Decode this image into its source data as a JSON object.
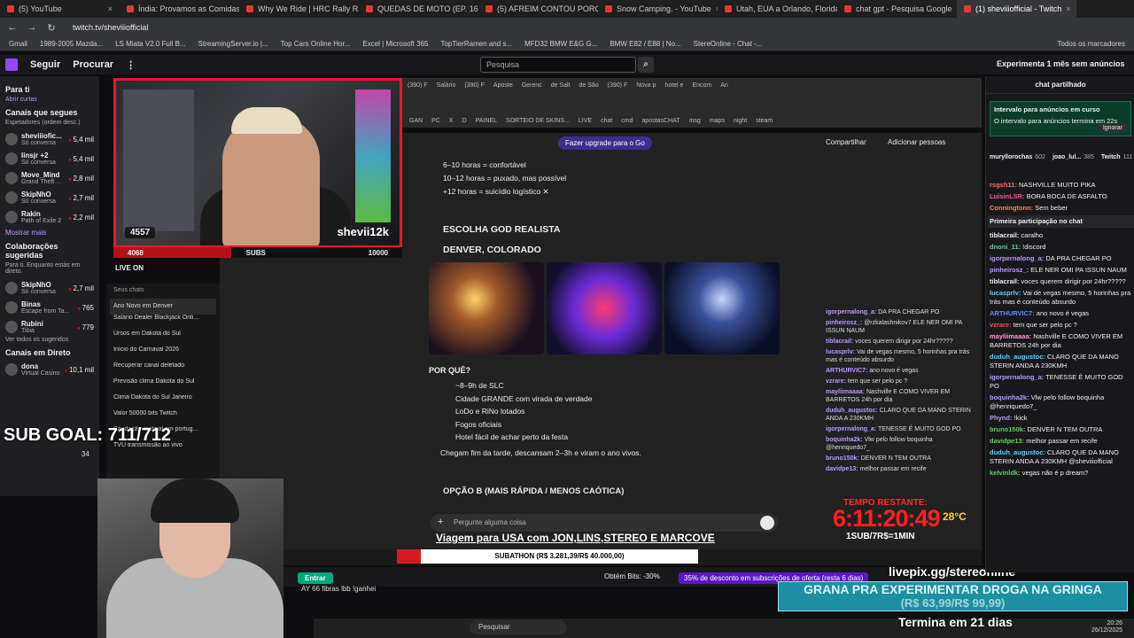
{
  "browser": {
    "tabs": [
      "(5) YouTube",
      "Índia: Provamos as Comidas d",
      "Why We Ride | HRC Rally Raid",
      "QUEDAS DE MOTO (EP. 163) -",
      "(5) AFREIM CONTOU PORQUE",
      "Snow Camping. - YouTube",
      "Utah, EUA a Orlando, Florida, E",
      "chat gpt - Pesquisa Google",
      "(1) sheviiiofficial - Twitch"
    ],
    "url": "twitch.tv/sheviiiofficial",
    "bookmarks": [
      "Gmail",
      "1989-2005 Mazda...",
      "LS Miata V2.0 Full B...",
      "StreamingServer.io |...",
      "Top Cars Online Hor...",
      "Excel | Microsoft 365",
      "TopTierRamen and s...",
      "MFD32 BMW E&G G...",
      "BMW E82 / E88 | No...",
      "StereOnline - Chat -..."
    ],
    "bookmarks_all": "Todos os marcadores"
  },
  "twitch": {
    "nav_following": "Seguir",
    "nav_browse": "Procurar",
    "search_placeholder": "Pesquisa",
    "promo": "Experimenta 1 mês sem anúncios"
  },
  "sidebar": {
    "for_you": "Para ti",
    "open_tabs": "Abrir curtas",
    "followed_title": "Canais que segues",
    "followed_sub": "Espetadores (ordem desc.)",
    "channels": [
      {
        "name": "sheviiiofic...",
        "game": "Só conversa",
        "viewers": "5,4 mil"
      },
      {
        "name": "linsjr +2",
        "game": "Só conversa",
        "viewers": "5,4 mil"
      },
      {
        "name": "Move_Mind",
        "game": "Grand Theft ...",
        "viewers": "2,8 mil"
      },
      {
        "name": "SkipNhO",
        "game": "Só conversa",
        "viewers": "2,7 mil"
      },
      {
        "name": "Rakin",
        "game": "Path of Exile 2",
        "viewers": "2,2 mil"
      }
    ],
    "show_more": "Mostrar mais",
    "collab_title": "Colaborações sugeridas",
    "collab_sub": "Para ti. Enquanto estás em direto.",
    "collab": [
      {
        "name": "SkipNhO",
        "game": "Só conversa",
        "viewers": "2,7 mil"
      },
      {
        "name": "Binas",
        "game": "Escape from Ta...",
        "viewers": "765"
      },
      {
        "name": "Rubini",
        "game": "Tibia",
        "viewers": "779"
      }
    ],
    "see_all": "Ver todos os sugeridos",
    "live_title": "Canais em Direto",
    "live": [
      {
        "name": "dona",
        "game": "Virtual Casino",
        "viewers": "10,1 mil"
      }
    ]
  },
  "stream": {
    "cam_name": "shevii12k",
    "cam_count": "4557",
    "bar_left": "4068",
    "bar_mid": "SUBS",
    "bar_right": "10000",
    "bar_fill": 0.4068,
    "live_on": "LIVE ON",
    "sub_goal": "SUB GOAL: 711/712",
    "sub_goal_small": "34",
    "viagem": "Viagem para USA com JON,LINS,STEREO E MARCOVE",
    "subathon": "SUBATHON (R$ 3.281,39/R$ 40.000,00)",
    "timer_label": "TEMPO RESTANTE:",
    "timer": "6:11:20:49",
    "temp": "28°C",
    "sub_rate": "1SUB/7R$=1MIN",
    "livepix": "livepix.gg/stereonline",
    "grana_line1": "GRANA PRA EXPERIMENTAR DROGA NA GRINGA",
    "grana_line2": "(R$ 63,99/R$ 99,99)",
    "termina": "Termina em 21 dias"
  },
  "inner_chats": {
    "header": "Seus chats",
    "items": [
      "Ano Novo em Denver",
      "Salário Dealer Blackjack Onli...",
      "Ursos em Dakota do Sul",
      "Início do Carnaval 2026",
      "Recuperar canal deletado",
      "Previsão clima Dakota do Sul",
      "Clima Dakota do Sul Janeiro",
      "Valor 50000 bits Twitch",
      "Saudação matinal em portug...",
      "TVU transmissão ao vivo"
    ]
  },
  "gpt": {
    "upgrade": "Fazer upgrade para o Go",
    "share": "Compartilhar",
    "add_people": "Adicionar pessoas",
    "lines": [
      "6–10 horas = confortável",
      "10–12 horas = puxado, mas possível",
      "+12 horas = suicídio logístico ✕"
    ],
    "heading1": "ESCOLHA GOD REALISTA",
    "heading2": "DENVER, COLORADO",
    "why": "POR QUÊ?",
    "reasons": [
      "~8–9h de SLC",
      "Cidade GRANDE com virada de verdade",
      "LoDo e RiNo lotados",
      "Fogos oficiais",
      "Hotel fácil de achar perto da festa"
    ],
    "arrive": "Chegam fim da tarde, descansam 2–3h e viram o ano vivos.",
    "option_b": "OPÇÃO B (MAIS RÁPIDA / MENOS CAÓTICA)",
    "ask_placeholder": "Pergunte alguma coisa"
  },
  "mid_chat": [
    {
      "user": "igorpernalong_a:",
      "text": "DA PRA CHEGAR PO"
    },
    {
      "user": "pinheirosz_:",
      "text": "@rzkalashnikov7 ELE NER OMI PA ISSUN NAUM"
    },
    {
      "user": "tiblacrail:",
      "text": "voces querem dirigir por 24hr?????"
    },
    {
      "user": "lucasprlv:",
      "text": "Vai de vegas mesmo, 5 horinhas pra trás mas é conteúdo absurdo"
    },
    {
      "user": "ARTHURVIC7:",
      "text": "ano novo é vegas"
    },
    {
      "user": "vzrare:",
      "text": "tem que ser pelo pc ?"
    },
    {
      "user": "mayliimaaaa:",
      "text": "Nashville E COMO VIVER EM BARRETOS 24h por dia"
    },
    {
      "user": "duduh_augustoc:",
      "text": "CLARO QUE DA MANO STERIN ANDA A 230KMH"
    },
    {
      "user": "igorpernalong_a:",
      "text": "TENESSE É MUITO GOD PO"
    },
    {
      "user": "boquinha2k:",
      "text": "Vlw pelo follow boquinha @henriquedo7_"
    },
    {
      "user": "bruno150k:",
      "text": "DENVER N TEM OUTRA"
    },
    {
      "user": "davidpe13:",
      "text": "melhor passar em recife"
    }
  ],
  "bottom": {
    "entrar": "Entrar",
    "bits": "Obtém Bits: -30%",
    "discount": "35% de desconto em subscrições de oferta (resta 6 dias)",
    "line2": "AY 66 fibras lbb !ganhei",
    "taskbar_search": "Pesquisar",
    "clock_time": "20:26",
    "clock_date": "26/12/2025"
  },
  "right_chat": {
    "header": "chat partilhado",
    "ad_title": "Intervalo para anúncios em curso",
    "ad_text": "O intervalo para anúncios termina em 22s",
    "ad_ignore": "Ignorar",
    "gifters": [
      {
        "name": "muryllorochas",
        "count": "602"
      },
      {
        "name": "joao_lul...",
        "count": "385"
      },
      {
        "name": "Twitch",
        "count": "111"
      }
    ],
    "first_msg_label": "Primeira participação no chat",
    "messages": [
      {
        "user": "rsgsh11:",
        "text": "NASHVILLE MUITO PIKA",
        "color": "#ff6b6b"
      },
      {
        "user": "LuisinLSR:",
        "text": "BORA BOCA DE ASFALTO",
        "color": "#ff4f9a"
      },
      {
        "user": "Conningtonn:",
        "text": "Sem beber",
        "color": "#ff8a3d"
      },
      {
        "user": "tiblacrail:",
        "text": "caralho",
        "color": "#efeff1"
      },
      {
        "user": "dnoni_11:",
        "text": "!discord",
        "color": "#5fd0a0"
      },
      {
        "user": "igorpernalong_a:",
        "text": "DA PRA CHEGAR PO",
        "color": "#b99aff"
      },
      {
        "user": "pinheirosz_:",
        "text": "ELE NER OMI PA ISSUN NAUM",
        "color": "#b99aff"
      },
      {
        "user": "tiblacrail:",
        "text": "voces querem dirigir por 24hr?????",
        "color": "#efeff1"
      },
      {
        "user": "lucasprlv:",
        "text": "Vai de vegas mesmo, 5 horinhas pra trás mas é conteúdo absurdo",
        "color": "#5fd0ff"
      },
      {
        "user": "ARTHURVIC7:",
        "text": "ano novo é vegas",
        "color": "#5f8cff"
      },
      {
        "user": "vzrare:",
        "text": "tem que ser pelo pc ?",
        "color": "#ff4f4f"
      },
      {
        "user": "mayliimaaaa:",
        "text": "Nashville E COMO VIVER EM BARRETOS 24h por dia",
        "color": "#ff9dd6"
      },
      {
        "user": "duduh_augustoc:",
        "text": "CLARO QUE DA MANO STERIN ANDA A 230KMH",
        "color": "#5fd0ff"
      },
      {
        "user": "igorpernalong_a:",
        "text": "TENESSE É MUITO GOD PO",
        "color": "#b99aff"
      },
      {
        "user": "boquinha2k:",
        "text": "Vlw pelo follow boquinha @henriquedo7_",
        "color": "#b99aff"
      },
      {
        "user": "Phynd:",
        "text": "!kick",
        "color": "#b99aff"
      },
      {
        "user": "bruno150k:",
        "text": "DENVER N TEM OUTRA",
        "color": "#5fd05f"
      },
      {
        "user": "davidpe13:",
        "text": "melhor passar em recife",
        "color": "#5fd05f"
      },
      {
        "user": "duduh_augustoc:",
        "text": "CLARO QUE DA MANO STERIN ANDA A 230KMH @sheviiiofficial",
        "color": "#5fd0ff"
      },
      {
        "user": "kelvinldk:",
        "text": "vegas não é p dream?",
        "color": "#5fd05f"
      }
    ]
  }
}
